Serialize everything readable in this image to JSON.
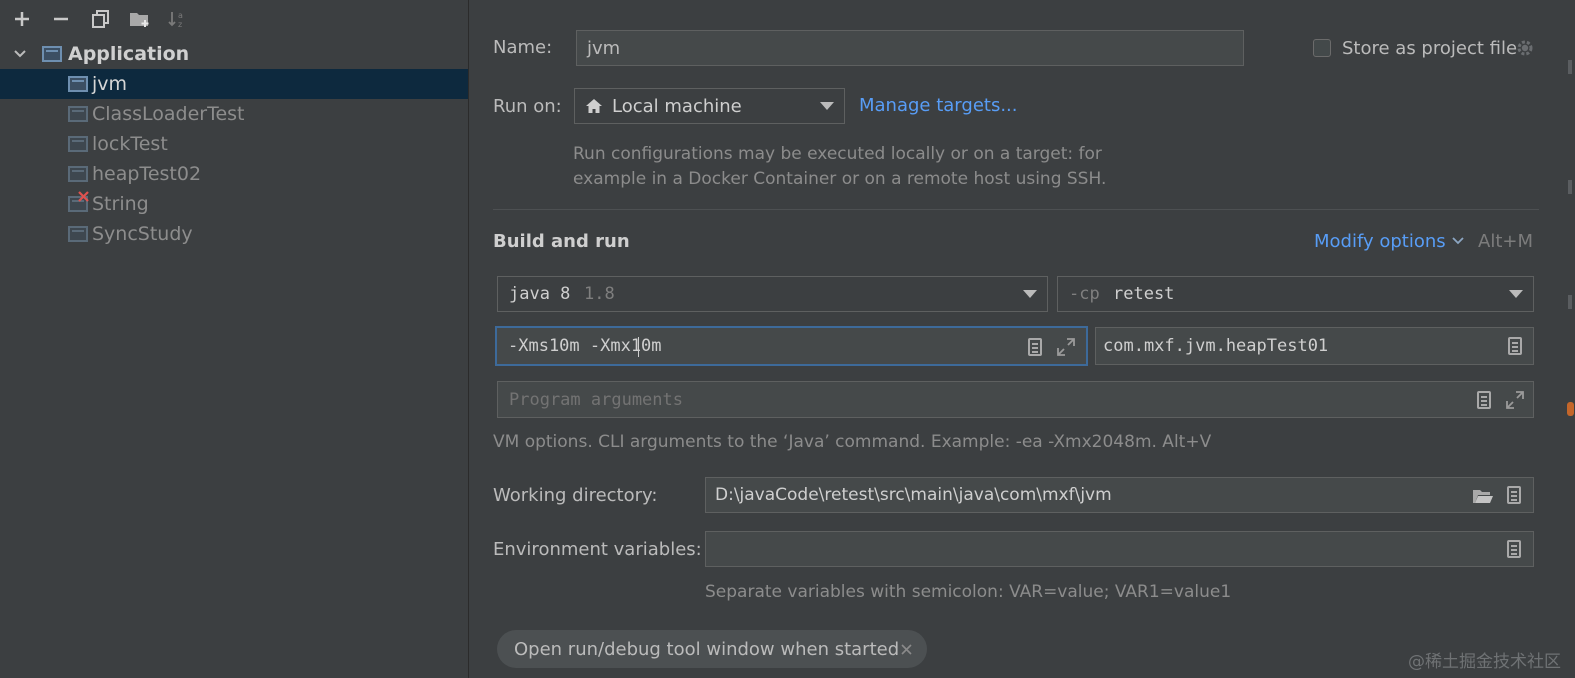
{
  "toolbar": {
    "icons": [
      "add-icon",
      "remove-icon",
      "copy-icon",
      "new-folder-icon",
      "sort-icon"
    ]
  },
  "tree": {
    "root_label": "Application",
    "items": [
      {
        "label": "jvm",
        "selected": true
      },
      {
        "label": "ClassLoaderTest"
      },
      {
        "label": "lockTest"
      },
      {
        "label": "heapTest02"
      },
      {
        "label": "String",
        "error": true
      },
      {
        "label": "SyncStudy"
      }
    ]
  },
  "form": {
    "name_label": "Name:",
    "name_value": "jvm",
    "store_label": "Store as project file",
    "run_on_label": "Run on:",
    "run_on_value": "Local machine",
    "manage_targets": "Manage targets...",
    "run_on_hint_1": "Run configurations may be executed locally or on a target: for",
    "run_on_hint_2": "example in a Docker Container or on a remote host using SSH.",
    "build_and_run": "Build and run",
    "modify_options": "Modify options",
    "modify_shortcut": "Alt+M",
    "jre_name": "java 8",
    "jre_version": "1.8",
    "cp_prefix": "-cp",
    "cp_value": "retest",
    "vm_options": "-Xms10m -Xmx10m",
    "main_class": "com.mxf.jvm.heapTest01",
    "program_args_placeholder": "Program arguments",
    "vm_hint": "VM options. CLI arguments to the ‘Java’ command. Example: -ea -Xmx2048m. Alt+V",
    "working_dir_label": "Working directory:",
    "working_dir_value": "D:\\javaCode\\retest\\src\\main\\java\\com\\mxf\\jvm",
    "env_label": "Environment variables:",
    "env_value": "",
    "env_hint": "Separate variables with semicolon: VAR=value; VAR1=value1",
    "open_tool_window_chip": "Open run/debug tool window when started"
  },
  "watermark": "@稀土掘金技术社区",
  "colors": {
    "background": "#3c3f41",
    "selection": "#0d293e",
    "link": "#589df6",
    "focus_border": "#3d6a9a",
    "error": "#e0524f"
  }
}
